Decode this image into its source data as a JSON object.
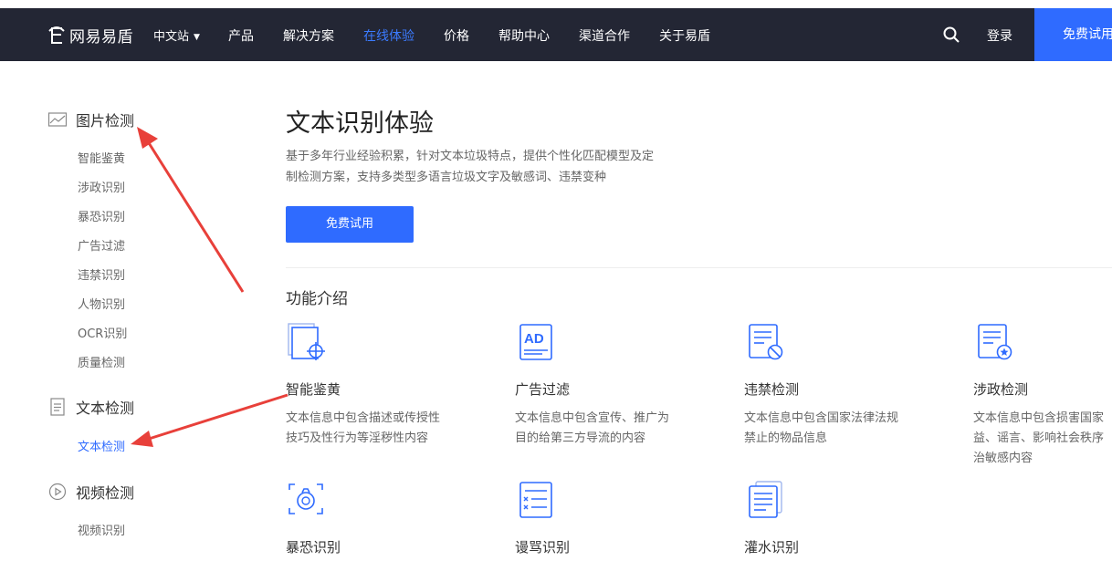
{
  "header": {
    "logo_text": "网易易盾",
    "lang": "中文站",
    "nav": [
      "产品",
      "解决方案",
      "在线体验",
      "价格",
      "帮助中心",
      "渠道合作",
      "关于易盾"
    ],
    "active_nav": "在线体验",
    "login": "登录",
    "trial": "免费试用",
    "accent_color": "#2f6bff",
    "bar_color": "#232634"
  },
  "sidebar": {
    "groups": [
      {
        "title": "图片检测",
        "icon": "image-icon",
        "items": [
          "智能鉴黄",
          "涉政识别",
          "暴恐识别",
          "广告过滤",
          "违禁识别",
          "人物识别",
          "OCR识别",
          "质量检测"
        ]
      },
      {
        "title": "文本检测",
        "icon": "document-icon",
        "items": [
          "文本检测"
        ],
        "active_item": "文本检测"
      },
      {
        "title": "视频检测",
        "icon": "play-icon",
        "items": [
          "视频识别"
        ]
      }
    ]
  },
  "main": {
    "title": "文本识别体验",
    "desc_lines": [
      "基于多年行业经验积累，针对文本垃圾特点，提供个性化匹配模型及定",
      "制检测方案，支持多类型多语言垃圾文字及敏感词、违禁变种"
    ],
    "trial_button": "免费试用",
    "section_title": "功能介绍",
    "features": [
      {
        "name": "智能鉴黄",
        "icon": "crosshair-doc-icon",
        "desc": [
          "文本信息中包含描述或传授性",
          "技巧及性行为等淫秽性内容"
        ]
      },
      {
        "name": "广告过滤",
        "icon": "ad-doc-icon",
        "desc": [
          "文本信息中包含宣传、推广为",
          "目的给第三方导流的内容"
        ]
      },
      {
        "name": "违禁检测",
        "icon": "prohibited-doc-icon",
        "desc": [
          "文本信息中包含国家法律法规",
          "禁止的物品信息"
        ]
      },
      {
        "name": "涉政检测",
        "icon": "star-doc-icon",
        "desc": [
          "文本信息中包含损害国家",
          "益、谣言、影响社会秩序",
          "治敏感内容"
        ]
      },
      {
        "name": "暴恐识别",
        "icon": "bomb-icon",
        "desc": []
      },
      {
        "name": "谩骂识别",
        "icon": "list-x-doc-icon",
        "desc": []
      },
      {
        "name": "灌水识别",
        "icon": "stacked-doc-icon",
        "desc": []
      }
    ]
  }
}
